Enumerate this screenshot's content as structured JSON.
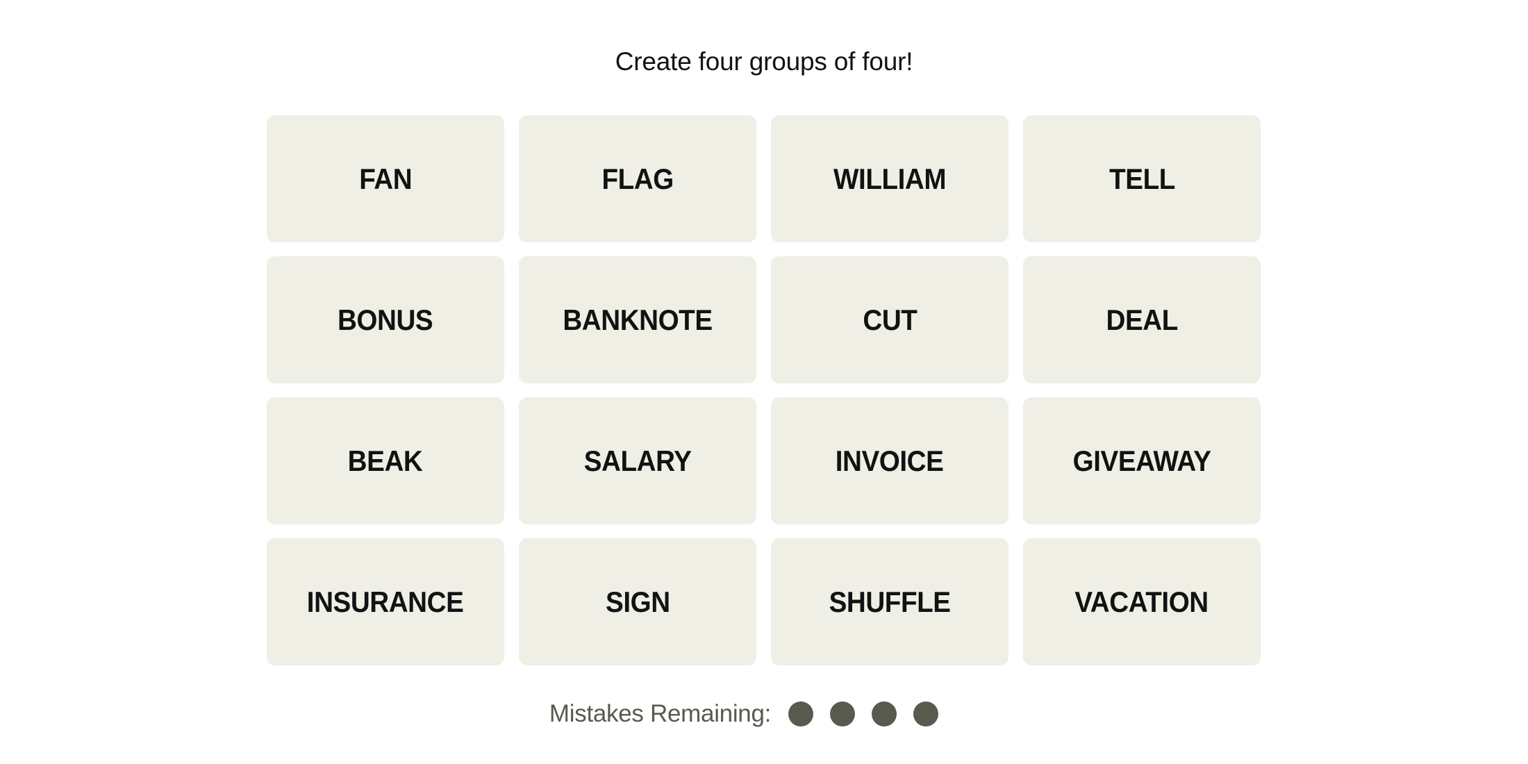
{
  "header": {
    "instructions": "Create four groups of four!"
  },
  "board": {
    "tiles": [
      {
        "label": "FAN"
      },
      {
        "label": "FLAG"
      },
      {
        "label": "WILLIAM"
      },
      {
        "label": "TELL"
      },
      {
        "label": "BONUS"
      },
      {
        "label": "BANKNOTE"
      },
      {
        "label": "CUT"
      },
      {
        "label": "DEAL"
      },
      {
        "label": "BEAK"
      },
      {
        "label": "SALARY"
      },
      {
        "label": "INVOICE"
      },
      {
        "label": "GIVEAWAY"
      },
      {
        "label": "INSURANCE"
      },
      {
        "label": "SIGN"
      },
      {
        "label": "SHUFFLE"
      },
      {
        "label": "VACATION"
      }
    ]
  },
  "mistakes": {
    "label": "Mistakes Remaining:",
    "remaining": 4,
    "total": 4
  },
  "colors": {
    "tile_background": "#efefe6",
    "tile_text": "#121212",
    "mistake_dot": "#5a594e",
    "mistake_label": "#5a594e",
    "page_background": "#ffffff"
  }
}
